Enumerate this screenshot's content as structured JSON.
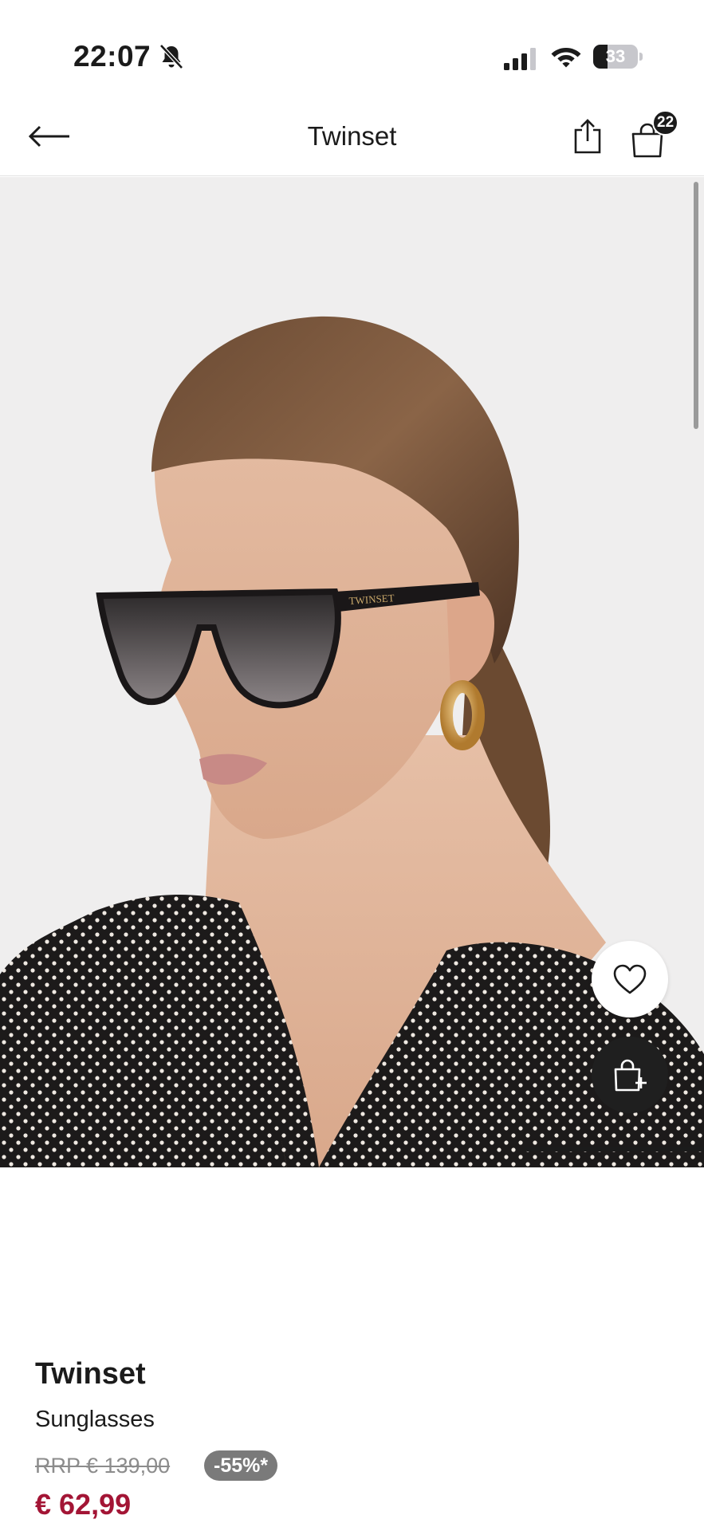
{
  "status_bar": {
    "time": "22:07",
    "battery_level": "33",
    "battery_fraction": 0.33
  },
  "header": {
    "title": "Twinset",
    "bag_count": "22",
    "icons": [
      "arrow-left-icon",
      "share-icon",
      "shopping-bag-icon"
    ]
  },
  "gallery": {
    "image": "model wearing black cat-eye sunglasses and polka dot blouse",
    "progress_fraction": 0.25,
    "icons": [
      "heart-icon",
      "bag-add-icon"
    ]
  },
  "product": {
    "brand": "Twinset",
    "category": "Sunglasses",
    "rrp": "RRP € 139,00",
    "discount": "-55%*",
    "price": "€ 62,99"
  },
  "colors": {
    "price": "#a31535",
    "badge": "#7a7a7a",
    "text": "#1b1b1b"
  }
}
